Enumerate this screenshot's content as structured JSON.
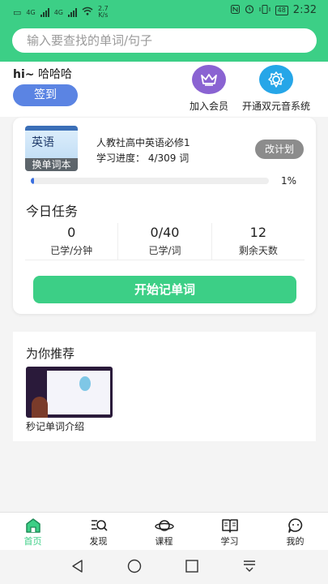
{
  "status_bar": {
    "left_signal_1": "4G",
    "left_signal_2": "4G",
    "net_speed_value": "2.7",
    "net_speed_unit": "K/s",
    "battery": "48",
    "time": "2:32"
  },
  "search": {
    "placeholder": "输入要查找的单词/句子"
  },
  "user": {
    "greeting": "hi~",
    "name": "哈哈哈",
    "signin_label": "签到"
  },
  "actions": [
    {
      "label": "加入会员",
      "icon": "crown-icon",
      "color": "#8a63d2"
    },
    {
      "label": "开通双元音系统",
      "icon": "gear-icon",
      "color": "#26a6e8"
    }
  ],
  "plan": {
    "cover_title": "英语",
    "change_book_label": "换单词本",
    "book_name": "人教社高中英语必修1",
    "progress_label": "学习进度：",
    "progress_value": "4/309 词",
    "change_plan_label": "改计划",
    "progress_fraction": 0.013,
    "progress_percent_text": "1%",
    "today_title": "今日任务",
    "stats": [
      {
        "value": "0",
        "label": "已学/分钟"
      },
      {
        "value": "0/40",
        "label": "已学/词"
      },
      {
        "value": "12",
        "label": "剩余天数"
      }
    ],
    "start_label": "开始记单词"
  },
  "recommend": {
    "title": "为你推荐",
    "item_caption": "秒记单词介绍"
  },
  "bottom_nav": [
    {
      "label": "首页",
      "icon": "home-icon",
      "active": true
    },
    {
      "label": "发现",
      "icon": "discover-icon",
      "active": false
    },
    {
      "label": "课程",
      "icon": "planet-icon",
      "active": false
    },
    {
      "label": "学习",
      "icon": "book-icon",
      "active": false
    },
    {
      "label": "我的",
      "icon": "chat-face-icon",
      "active": false
    }
  ],
  "colors": {
    "brand": "#3ccf86",
    "signin": "#5b84e3",
    "progress": "#3a6fe0"
  }
}
